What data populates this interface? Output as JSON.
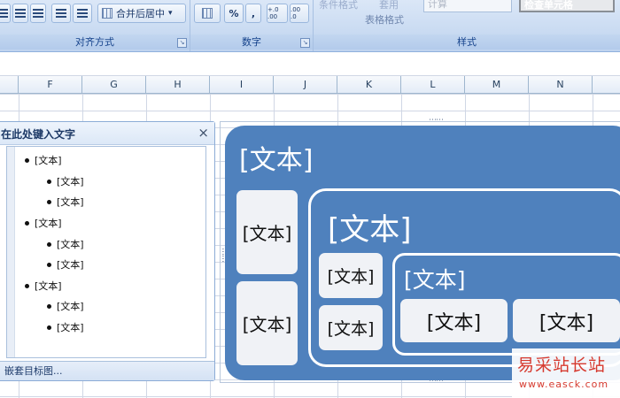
{
  "ribbon": {
    "alignment": {
      "label": "对齐方式",
      "merge_center_label": "合并后居中",
      "dropdown_arrow": "▾"
    },
    "number": {
      "label": "数字",
      "percent": "%",
      "comma": ",",
      "increase_decimals": "+.0 .00",
      "decrease_decimals": ".00 .0"
    },
    "styles": {
      "label": "样式",
      "conditional_formatting_label": "条件格式",
      "format_as_table_top": "套用",
      "format_as_table_label": "表格格式",
      "style_calc": "计算",
      "style_check_cell": "检查单元格"
    }
  },
  "columns": [
    "F",
    "G",
    "H",
    "I",
    "J",
    "K",
    "L",
    "M",
    "N"
  ],
  "text_pane": {
    "title": "在此处键入文字",
    "close": "×",
    "items": [
      {
        "level": 1,
        "text": "[文本]"
      },
      {
        "level": 2,
        "text": "[文本]"
      },
      {
        "level": 2,
        "text": "[文本]"
      },
      {
        "level": 1,
        "text": "[文本]"
      },
      {
        "level": 2,
        "text": "[文本]"
      },
      {
        "level": 2,
        "text": "[文本]"
      },
      {
        "level": 1,
        "text": "[文本]"
      },
      {
        "level": 2,
        "text": "[文本]"
      },
      {
        "level": 2,
        "text": "[文本]"
      }
    ],
    "footer": "嵌套目标图..."
  },
  "diagram": {
    "outer_title": "[文本]",
    "outer_boxes": [
      "[文本]",
      "[文本]"
    ],
    "middle_title": "[文本]",
    "middle_boxes": [
      "[文本]",
      "[文本]"
    ],
    "inner_title": "[文本]",
    "inner_boxes": [
      "[文本]",
      "[文本]"
    ],
    "handle_dots": "⋯⋯"
  },
  "watermark": {
    "title": "易采站长站",
    "url": "www.easck.com"
  },
  "colors": {
    "diagram_blue": "#4f81bd",
    "box_fill": "#f0f2f6",
    "watermark_red": "#d63a2f"
  }
}
